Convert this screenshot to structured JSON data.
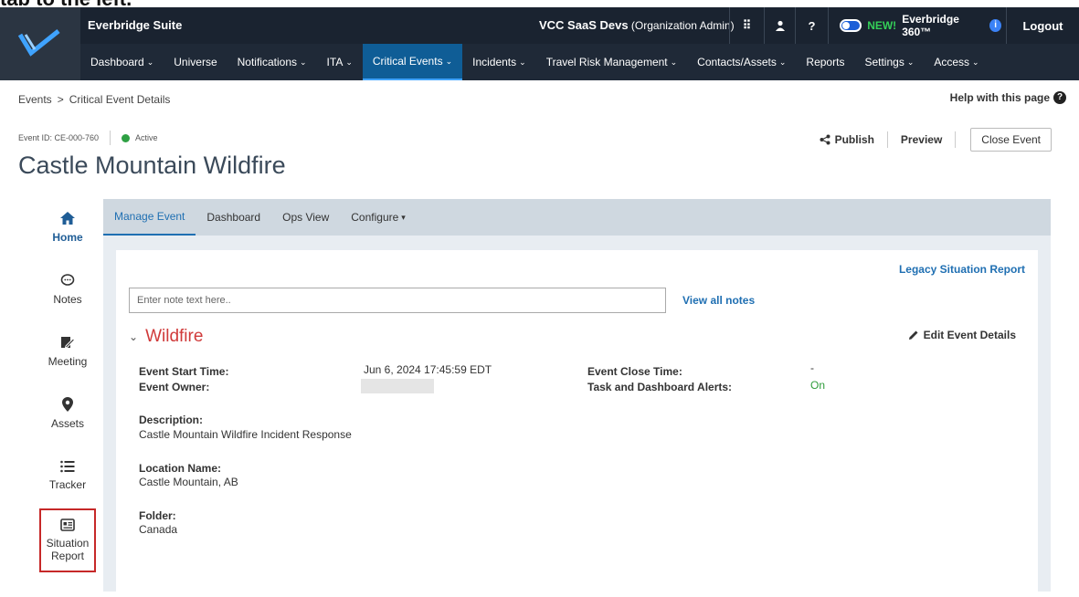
{
  "header": {
    "suite_name": "Everbridge Suite",
    "org_name": "VCC SaaS Devs",
    "org_role": "(Organization Admin)",
    "new_label": "NEW!",
    "product_360": "Everbridge 360™",
    "logout": "Logout",
    "help_symbol": "?"
  },
  "nav": {
    "items": [
      {
        "label": "Dashboard",
        "chevron": true
      },
      {
        "label": "Universe",
        "chevron": false
      },
      {
        "label": "Notifications",
        "chevron": true
      },
      {
        "label": "ITA",
        "chevron": true
      },
      {
        "label": "Critical Events",
        "chevron": true
      },
      {
        "label": "Incidents",
        "chevron": true
      },
      {
        "label": "Travel Risk Management",
        "chevron": true
      },
      {
        "label": "Contacts/Assets",
        "chevron": true
      },
      {
        "label": "Reports",
        "chevron": false
      },
      {
        "label": "Settings",
        "chevron": true
      },
      {
        "label": "Access",
        "chevron": true
      }
    ],
    "active": "Critical Events"
  },
  "breadcrumb": {
    "root": "Events",
    "separator": ">",
    "current": "Critical Event Details"
  },
  "help_link": "Help with this page",
  "event": {
    "id_label": "Event ID: CE-000-760",
    "status": "Active",
    "title": "Castle Mountain Wildfire"
  },
  "actions": {
    "publish": "Publish",
    "preview": "Preview",
    "close_event": "Close Event"
  },
  "sidebar": {
    "items": [
      {
        "label": "Home",
        "icon": "home-icon"
      },
      {
        "label": "Notes",
        "icon": "chat-bubble-icon"
      },
      {
        "label": "Meeting",
        "icon": "meeting-icon"
      },
      {
        "label": "Assets",
        "icon": "map-pin-icon"
      },
      {
        "label": "Tracker",
        "icon": "list-icon"
      },
      {
        "label": "Situation Report",
        "icon": "report-icon"
      }
    ]
  },
  "tabs": {
    "items": [
      "Manage Event",
      "Dashboard",
      "Ops View",
      "Configure"
    ]
  },
  "card": {
    "legacy_link": "Legacy Situation Report",
    "note_placeholder": "Enter note text here..",
    "view_all_notes": "View all notes",
    "section_title": "Wildfire",
    "edit_details": "Edit Event Details",
    "fields": {
      "start_time_label": "Event Start Time:",
      "start_time_value": "Jun 6, 2024 17:45:59 EDT",
      "owner_label": "Event Owner:",
      "close_time_label": "Event Close Time:",
      "close_time_value": "-",
      "alerts_label": "Task and Dashboard Alerts:",
      "alerts_value": "On",
      "description_label": "Description:",
      "description_value": "Castle Mountain Wildfire Incident Response",
      "location_label": "Location Name:",
      "location_value": "Castle Mountain, AB",
      "folder_label": "Folder:",
      "folder_value": "Canada"
    }
  },
  "colors": {
    "header_bg": "#1f2937",
    "active_nav": "#0f5d96",
    "link": "#1f6fb2",
    "section_title": "#d03a3a",
    "status_green": "#2ea043",
    "highlight_box": "#c62828"
  }
}
